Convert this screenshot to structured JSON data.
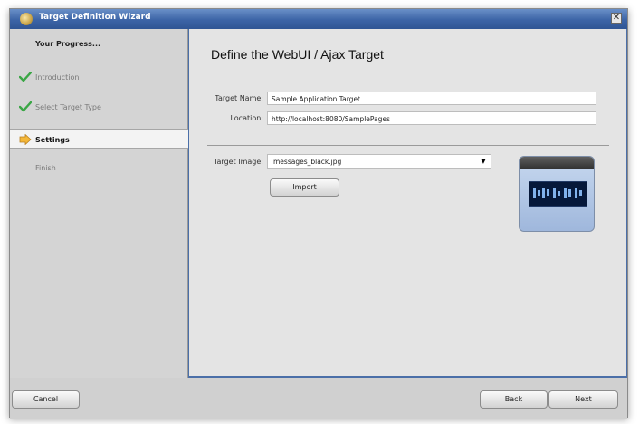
{
  "window": {
    "title": "Target Definition Wizard",
    "close_glyph": "✕"
  },
  "sidebar": {
    "title": "Your Progress...",
    "steps": [
      {
        "label": "Introduction",
        "state": "done",
        "icon": "checkmark-icon"
      },
      {
        "label": "Select Target Type",
        "state": "done",
        "icon": "checkmark-icon"
      },
      {
        "label": "Settings",
        "state": "current",
        "icon": "arrow-right-icon"
      },
      {
        "label": "Finish",
        "state": "pending",
        "icon": ""
      }
    ]
  },
  "content": {
    "heading": "Define the WebUI / Ajax Target",
    "target_name": {
      "label": "Target Name:",
      "value": "Sample Application Target"
    },
    "location": {
      "label": "Location:",
      "value": "http://localhost:8080/SamplePages"
    },
    "target_image": {
      "label": "Target Image:",
      "value": "messages_black.jpg"
    },
    "import_label": "Import"
  },
  "footer": {
    "cancel_label": "Cancel",
    "back_label": "Back",
    "next_label": "Next"
  },
  "colors": {
    "title_bar": "#3c64a6",
    "check": "#3aa645",
    "arrow": "#f4b738"
  }
}
